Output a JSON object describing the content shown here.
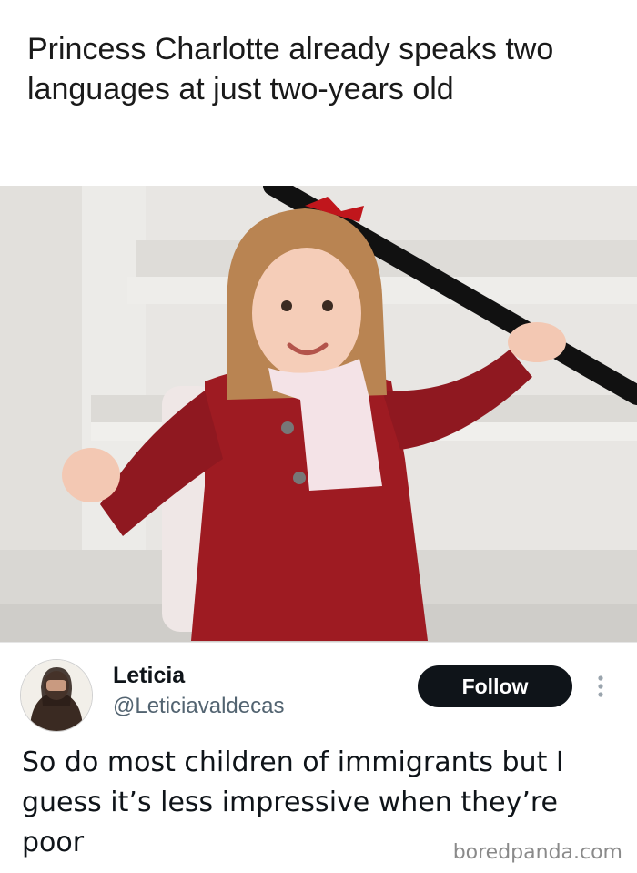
{
  "headline": "Princess Charlotte already speaks two languages at just two-years old",
  "tweet": {
    "display_name": "Leticia",
    "handle": "@Leticiavaldecas",
    "follow_label": "Follow",
    "text": "So do most children of immigrants but I guess it’s less impressive when they’re poor"
  },
  "watermark": "boredpanda.com",
  "colors": {
    "follow_button": "#0f1419",
    "coat_red": "#9e1b22",
    "handle_gray": "#536471"
  },
  "icons": {
    "more": "more-vertical-icon"
  }
}
